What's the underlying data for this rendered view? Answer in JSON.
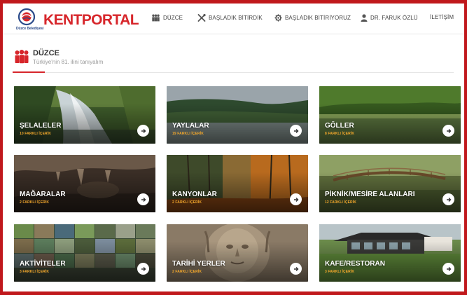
{
  "brand": {
    "logo_text_kent": "KENT",
    "logo_text_portal": "PORTAL",
    "logo_sub": "Düzce Belediyesi"
  },
  "nav": {
    "items": [
      {
        "label": "DÜZCE",
        "icon": "people-icon"
      },
      {
        "label": "BAŞLADIK BİTİRDİK",
        "icon": "tools-icon"
      },
      {
        "label": "BAŞLADIK BİTİRİYORUZ",
        "icon": "gear-icon"
      },
      {
        "label": "DR. FARUK ÖZLÜ",
        "icon": "person-icon"
      },
      {
        "label": "İLETİŞİM",
        "icon": ""
      }
    ]
  },
  "section": {
    "title": "DÜZCE",
    "subtitle": "Türkiye'nin 81. ilini tanıyalım",
    "icon": "people-icon"
  },
  "colors": {
    "brand_red": "#d7262b",
    "count_orange": "#f2a72c",
    "frame_red": "#c0181c"
  },
  "cards": [
    {
      "title": "ŞELALELER",
      "count": "10 FARKLI İÇERİK",
      "image": "waterfall"
    },
    {
      "title": "YAYLALAR",
      "count": "19 FARKLI İÇERİK",
      "image": "plateau"
    },
    {
      "title": "GÖLLER",
      "count": "8 FARKLI İÇERİK",
      "image": "lake"
    },
    {
      "title": "MAĞARALAR",
      "count": "2 FARKLI İÇERİK",
      "image": "cave"
    },
    {
      "title": "KANYONLAR",
      "count": "2 FARKLI İÇERİK",
      "image": "canyon"
    },
    {
      "title": "PİKNİK/MESİRE ALANLARI",
      "count": "12 FARKLI İÇERİK",
      "image": "picnic-bridge"
    },
    {
      "title": "AKTİVİTELER",
      "count": "3 FARKLI İÇERİK",
      "image": "activity-collage"
    },
    {
      "title": "TARİHİ YERLER",
      "count": "2 FARKLI İÇERİK",
      "image": "stone-relief"
    },
    {
      "title": "KAFE/RESTORAN",
      "count": "3 FARKLI İÇERİK",
      "image": "cafe-building"
    }
  ]
}
